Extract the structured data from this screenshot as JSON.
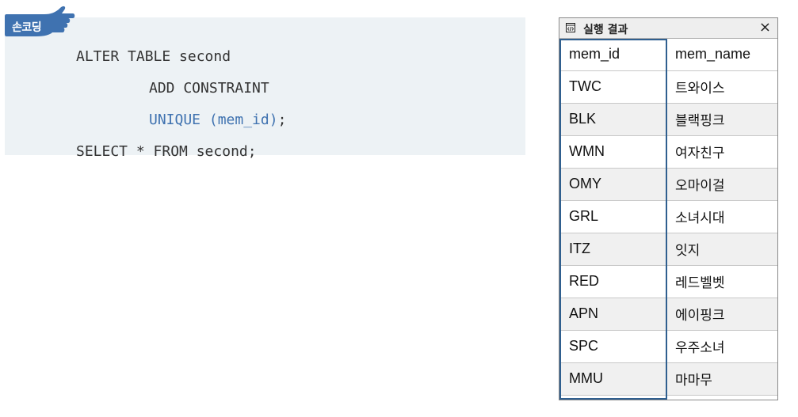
{
  "code_box": {
    "badge": "손코딩",
    "lines": [
      "ALTER TABLE second",
      "ADD CONSTRAINT",
      "UNIQUE (mem_id)",
      ";",
      "SELECT * FROM second;"
    ]
  },
  "result_panel": {
    "title": "실행 결과",
    "close_glyph": "×",
    "icon": "code-window-icon",
    "headers": [
      "mem_id",
      "mem_name"
    ],
    "rows": [
      {
        "mem_id": "TWC",
        "mem_name": "트와이스"
      },
      {
        "mem_id": "BLK",
        "mem_name": "블랙핑크"
      },
      {
        "mem_id": "WMN",
        "mem_name": "여자친구"
      },
      {
        "mem_id": "OMY",
        "mem_name": "오마이걸"
      },
      {
        "mem_id": "GRL",
        "mem_name": "소녀시대"
      },
      {
        "mem_id": "ITZ",
        "mem_name": "잇지"
      },
      {
        "mem_id": "RED",
        "mem_name": "레드벨벳"
      },
      {
        "mem_id": "APN",
        "mem_name": "에이핑크"
      },
      {
        "mem_id": "SPC",
        "mem_name": "우주소녀"
      },
      {
        "mem_id": "MMU",
        "mem_name": "마마무"
      }
    ]
  },
  "colors": {
    "code_background": "#edf2f5",
    "badge": "#3f72b0",
    "keyword_highlight": "#3f72b0",
    "column_highlight": "#2f5f8f",
    "row_shade": "#f0f0f0"
  }
}
